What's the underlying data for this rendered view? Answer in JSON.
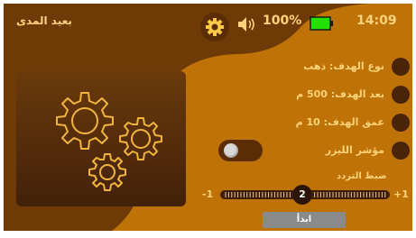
{
  "header": {
    "app_title": "بعيد المدى",
    "battery_percent": "100%",
    "clock": "14:09",
    "icons": {
      "settings": "gear-icon",
      "volume": "speaker-icon",
      "battery": "battery-icon"
    }
  },
  "settings": [
    {
      "label": "نوع الهدف: ذهب"
    },
    {
      "label": "بعد الهدف: 500 م"
    },
    {
      "label": "عمق الهدف: 10 م"
    },
    {
      "label": "مؤشر الليزر"
    }
  ],
  "laser_toggle": {
    "on": false
  },
  "frequency": {
    "label": "ضبط التردد",
    "min_label": "-1",
    "max_label": "+1",
    "value": "2"
  },
  "start_button": {
    "label": "ابدأ"
  },
  "colors": {
    "background": "#bf7206",
    "wave": "#6e3a06",
    "text": "#ffd37a",
    "battery_fill": "#22e000"
  }
}
